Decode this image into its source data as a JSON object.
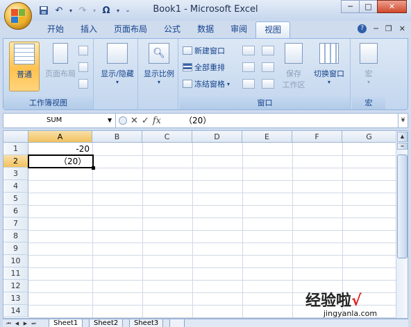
{
  "window": {
    "title": "Book1 - Microsoft Excel"
  },
  "ribbon": {
    "tabs": [
      "开始",
      "插入",
      "页面布局",
      "公式",
      "数据",
      "审阅",
      "视图"
    ],
    "active_tab": "视图",
    "groups": {
      "workbook_views": {
        "label": "工作簿视图",
        "normal": "普通",
        "page_layout": "页面布局"
      },
      "show_hide": {
        "label": "显示/隐藏"
      },
      "zoom": {
        "label": "显示比例"
      },
      "window": {
        "label": "窗口",
        "new_window": "新建窗口",
        "arrange_all": "全部重排",
        "freeze_panes": "冻结窗格",
        "save_workspace": "保存\n工作区",
        "save_line1": "保存",
        "save_line2": "工作区",
        "switch_windows": "切换窗口"
      },
      "macros": {
        "label": "宏",
        "macros": "宏"
      }
    }
  },
  "formula_bar": {
    "name_box": "SUM",
    "cancel": "✕",
    "enter": "✓",
    "fx": "fx",
    "content": "（20）"
  },
  "columns": [
    "A",
    "B",
    "C",
    "D",
    "E",
    "F",
    "G"
  ],
  "rows": [
    "1",
    "2",
    "3",
    "4",
    "5",
    "6",
    "7",
    "8",
    "9",
    "10",
    "11",
    "12",
    "13",
    "14"
  ],
  "cells": {
    "A1": "-20",
    "A2": "（20）"
  },
  "active_cell": "A2",
  "sheets": [
    "Sheet1",
    "Sheet2",
    "Sheet3"
  ],
  "active_sheet": "Sheet1",
  "watermark": {
    "text": "经验啦",
    "check": "√",
    "url": "jingyanla.com"
  }
}
